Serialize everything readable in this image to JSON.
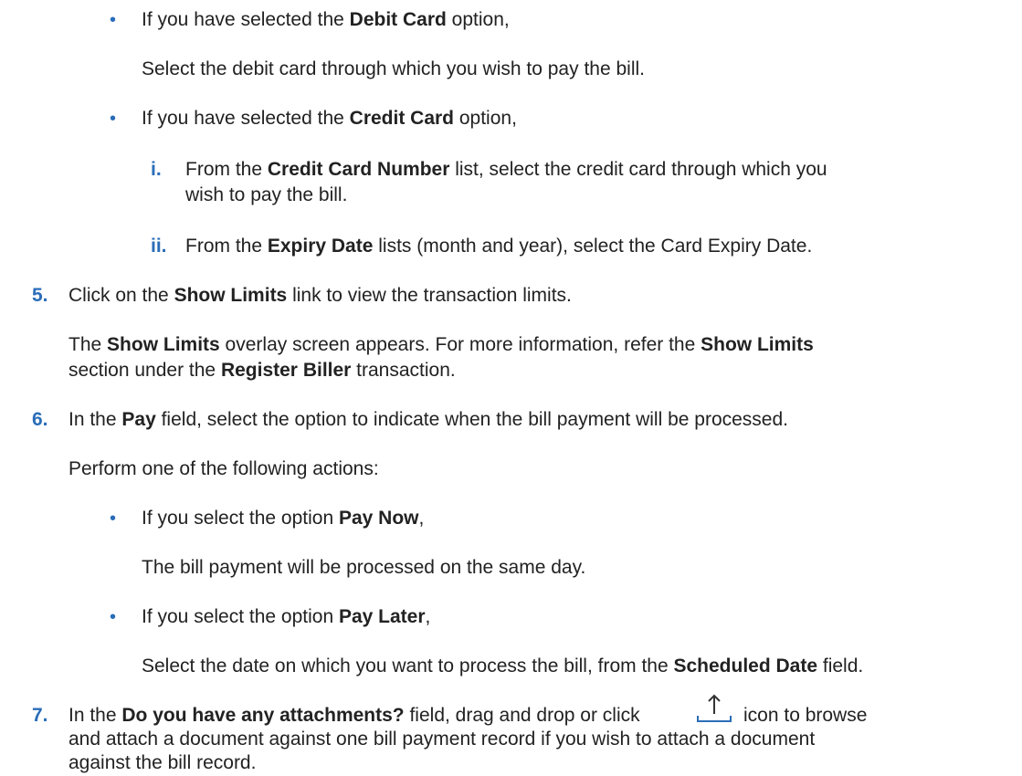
{
  "bullet_glyph": "•",
  "debit": {
    "pre": "If you have selected the ",
    "bold": "Debit Card",
    "post": " option,",
    "detail": "Select the debit card through which you wish to pay the bill."
  },
  "credit": {
    "pre": "If you have selected the ",
    "bold": "Credit Card",
    "post": " option,",
    "sub1": {
      "label": "i.",
      "pre": "From the ",
      "bold": "Credit Card Number",
      "post": " list, select the credit card through which you",
      "line2": "wish to pay the bill."
    },
    "sub2": {
      "label": "ii.",
      "pre": "From the ",
      "bold": "Expiry Date",
      "post": " lists (month and year), select the Card Expiry Date."
    }
  },
  "step5": {
    "num": "5.",
    "pre": "Click on the ",
    "bold": "Show Limits",
    "post": " link to view the transaction limits.",
    "p_pre": "The ",
    "p_bold1": "Show Limits",
    "p_mid": " overlay screen appears. For more information, refer the ",
    "p_bold2": "Show Limits",
    "p2_bold": "Register Biller",
    "p2_pre": "section under the ",
    "p2_post": " transaction."
  },
  "step6": {
    "num": "6.",
    "pre": "In the ",
    "bold": "Pay",
    "post": " field, select the option to indicate when the bill payment will be processed.",
    "perform": "Perform one of the following actions:",
    "now": {
      "pre": "If you select the option ",
      "bold": "Pay Now",
      "post": ",",
      "detail": "The bill payment will be processed on the same day."
    },
    "later": {
      "pre": "If you select the option ",
      "bold": "Pay Later",
      "post": ",",
      "detail_pre": "Select the date on which you want to process the bill, from the ",
      "detail_bold": "Scheduled Date",
      "detail_post": " field."
    }
  },
  "step7": {
    "num": "7.",
    "pre": "In the ",
    "bold": "Do you have any attachments?",
    "mid": " field, drag and drop or click ",
    "post": " icon to browse",
    "line2": "and attach a document against one bill payment record if you wish to attach a document",
    "line3": "against the bill record."
  },
  "colors": {
    "accent": "#2a6db8",
    "text": "#222222"
  },
  "icons": {
    "upload": "upload-icon"
  }
}
